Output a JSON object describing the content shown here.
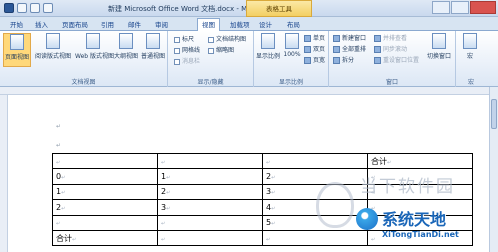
{
  "title_bar": {
    "document_title": "新建 Microsoft Office Word 文档.docx - Microso...",
    "context_tool": "表格工具"
  },
  "tabs": [
    "开始",
    "插入",
    "页面布局",
    "引用",
    "邮件",
    "审阅",
    "视图",
    "加载项",
    "设计",
    "布局"
  ],
  "active_tab": "视图",
  "ribbon": {
    "document_views": {
      "label": "文档视图",
      "buttons": [
        "页面视图",
        "阅读版式视图",
        "Web 版式视图",
        "大纲视图",
        "普通视图"
      ],
      "selected": "页面视图"
    },
    "show_hide": {
      "label": "显示/隐藏",
      "checkboxes": [
        {
          "label": "标尺",
          "checked": false
        },
        {
          "label": "网格线",
          "checked": false
        },
        {
          "label": "消息栏",
          "checked": false,
          "disabled": true
        },
        {
          "label": "文档结构图",
          "checked": false
        },
        {
          "label": "缩略图",
          "checked": false
        }
      ]
    },
    "zoom": {
      "label": "显示比例",
      "buttons": [
        "显示比例",
        "100%"
      ],
      "small_buttons": [
        "单页",
        "双页",
        "页宽"
      ]
    },
    "window": {
      "label": "窗口",
      "buttons": [
        "新建窗口",
        "全部重排",
        "拆分"
      ],
      "disabled_buttons": [
        "并排查看",
        "同步滚动",
        "重设窗口位置"
      ],
      "switch_button": "切换窗口"
    },
    "macros": {
      "label": "宏",
      "button": "宏"
    }
  },
  "document": {
    "paragraph_mark": "↵",
    "table": {
      "rows": [
        [
          "",
          "",
          "",
          "合计"
        ],
        [
          "0",
          "1",
          "2",
          ""
        ],
        [
          "1",
          "2",
          "3",
          ""
        ],
        [
          "2",
          "3",
          "4",
          ""
        ],
        [
          "",
          "",
          "5",
          ""
        ],
        [
          "合计",
          "",
          "",
          ""
        ]
      ]
    }
  },
  "watermark": {
    "line1": "当下软件园",
    "line2": "系统天地",
    "url": "XiTongTianDi.net"
  }
}
